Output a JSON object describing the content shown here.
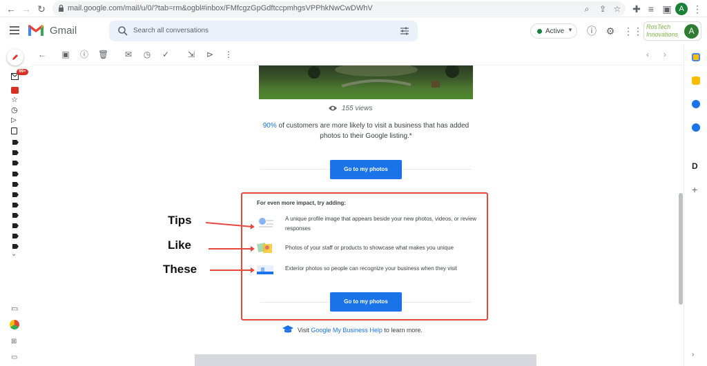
{
  "browser": {
    "url": "mail.google.com/mail/u/0/?tab=rm&ogbl#inbox/FMfcgzGpGdftccpmhgsVPPhkNwCwDWhV",
    "profile_initial": "A",
    "icons": [
      "back-icon",
      "forward-icon",
      "reload-icon",
      "lock-icon",
      "zoom-icon",
      "share-icon",
      "star-icon",
      "extensions-icon",
      "reading-list-icon",
      "side-panel-icon",
      "kebab-menu-icon"
    ]
  },
  "gmail": {
    "brand": "Gmail",
    "search_placeholder": "Search all conversations",
    "status": "Active",
    "org_logo_text": "RosTech Innovations",
    "account_initial": "A",
    "inbox_badge": "99+",
    "colors": {
      "blue": "#1a73e8",
      "red": "#d93025",
      "annotation": "#e8473c"
    }
  },
  "email": {
    "views": "155 views",
    "stat_pct": "90%",
    "stat_text": " of customers are more likely to visit a business that has added photos to their Google listing.*",
    "button": "Go to my photos",
    "tips_heading": "For even more impact, try adding:",
    "tips": [
      {
        "text": "A unique profile image that appears beside your new photos, videos, or review responses"
      },
      {
        "text": "Photos of your staff or products to showcase what makes you unique"
      },
      {
        "text": "Exterior photos so people can recognize your business when they visit"
      }
    ],
    "button2": "Go to my photos",
    "help_prefix": "Visit ",
    "help_link": "Google My Business Help",
    "help_suffix": " to learn more."
  },
  "annotations": {
    "word1": "Tips",
    "word2": "Like",
    "word3": "These"
  }
}
